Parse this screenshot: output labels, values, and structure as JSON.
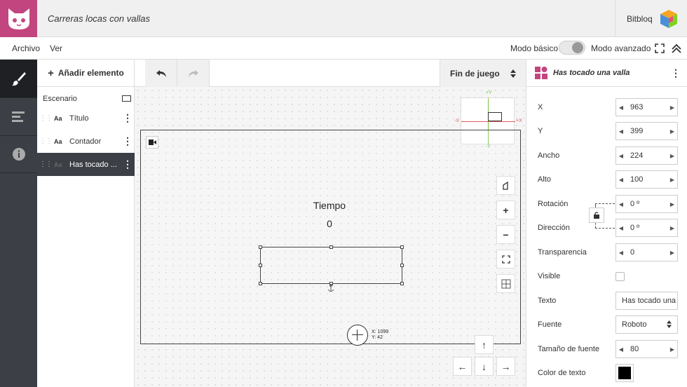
{
  "app": {
    "title": "Carreras locas con vallas",
    "brand": "Bitbloq"
  },
  "menu": {
    "file": "Archivo",
    "view": "Ver",
    "mode_basic": "Modo básico",
    "mode_advanced": "Modo avanzado"
  },
  "elements": {
    "add_label": "Añadir elemento",
    "scene_label": "Escenario",
    "items": [
      {
        "icon": "Aa",
        "label": "Título"
      },
      {
        "icon": "Aa",
        "label": "Contador"
      },
      {
        "icon": "Aa",
        "label": "Has tocado ..."
      }
    ]
  },
  "toolbar": {
    "end_game": "Fin de juego"
  },
  "canvas": {
    "time_label": "Tiempo",
    "time_value": "0",
    "coord_x": "X: 1099",
    "coord_y": "Y: 42",
    "axis_px": "+X",
    "axis_nx": "-X",
    "axis_py": "+Y",
    "axis_ny": "-Y"
  },
  "props": {
    "title": "Has tocado una valla",
    "x_label": "X",
    "x_value": "963",
    "y_label": "Y",
    "y_value": "399",
    "width_label": "Ancho",
    "width_value": "224",
    "height_label": "Alto",
    "height_value": "100",
    "rotation_label": "Rotación",
    "rotation_value": "0 º",
    "direction_label": "Dirección",
    "direction_value": "0 º",
    "transparency_label": "Transparencia",
    "transparency_value": "0",
    "visible_label": "Visible",
    "text_label": "Texto",
    "text_value": "Has tocado una",
    "font_label": "Fuente",
    "font_value": "Roboto",
    "font_size_label": "Tamaño de fuente",
    "font_size_value": "80",
    "text_color_label": "Color de texto",
    "text_color": "#000000"
  },
  "colors": {
    "logo_bg": "#c2457f",
    "sidebar_bg": "#3c3f45",
    "accent_pink": "#c2457f"
  }
}
